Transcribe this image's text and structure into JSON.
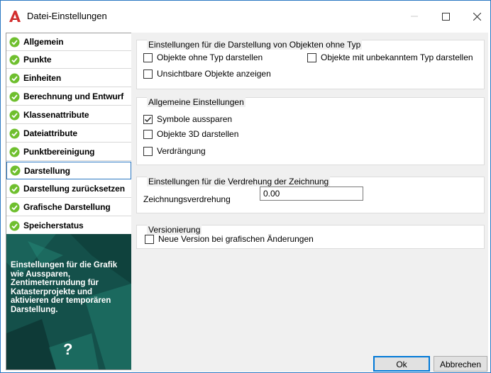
{
  "window": {
    "title": "Datei-Einstellungen"
  },
  "sidebar": {
    "items": [
      {
        "label": "Allgemein"
      },
      {
        "label": "Punkte"
      },
      {
        "label": "Einheiten"
      },
      {
        "label": "Berechnung und Entwurf"
      },
      {
        "label": "Klassenattribute"
      },
      {
        "label": "Dateiattribute"
      },
      {
        "label": "Punktbereinigung"
      },
      {
        "label": "Darstellung"
      },
      {
        "label": "Darstellung zurücksetzen"
      },
      {
        "label": "Grafische Darstellung"
      },
      {
        "label": "Speicherstatus"
      }
    ],
    "selected": "Darstellung",
    "help_text": "Einstellungen für die Grafik wie Aussparen, Zentimeterrundung für Katasterprojekte und aktivieren der temporären Darstellung.",
    "help_symbol": "?"
  },
  "groups": {
    "untyped": {
      "title": "Einstellungen für die Darstellung von Objekten ohne Typ",
      "show_untyped": {
        "label": "Objekte ohne Typ darstellen",
        "checked": false
      },
      "show_unknown": {
        "label": "Objekte mit unbekanntem Typ darstellen",
        "checked": false
      },
      "show_invisible": {
        "label": "Unsichtbare Objekte anzeigen",
        "checked": false
      }
    },
    "general": {
      "title": "Allgemeine Einstellungen",
      "symbols": {
        "label": "Symbole aussparen",
        "checked": true
      },
      "objects3d": {
        "label": "Objekte 3D darstellen",
        "checked": false
      },
      "displacement": {
        "label": "Verdrängung",
        "checked": false
      }
    },
    "rotation": {
      "title": "Einstellungen für die Verdrehung der Zeichnung",
      "label": "Zeichnungsverdrehung",
      "value": "0.00"
    },
    "versioning": {
      "title": "Versionierung",
      "new_version": {
        "label": "Neue Version bei grafischen Änderungen",
        "checked": false
      }
    }
  },
  "buttons": {
    "ok": "Ok",
    "cancel": "Abbrechen"
  },
  "colors": {
    "accent": "#2b78c2",
    "check_green": "#6fbf2e",
    "help_bg": "#14504a",
    "app_icon_red": "#d32f2f"
  }
}
